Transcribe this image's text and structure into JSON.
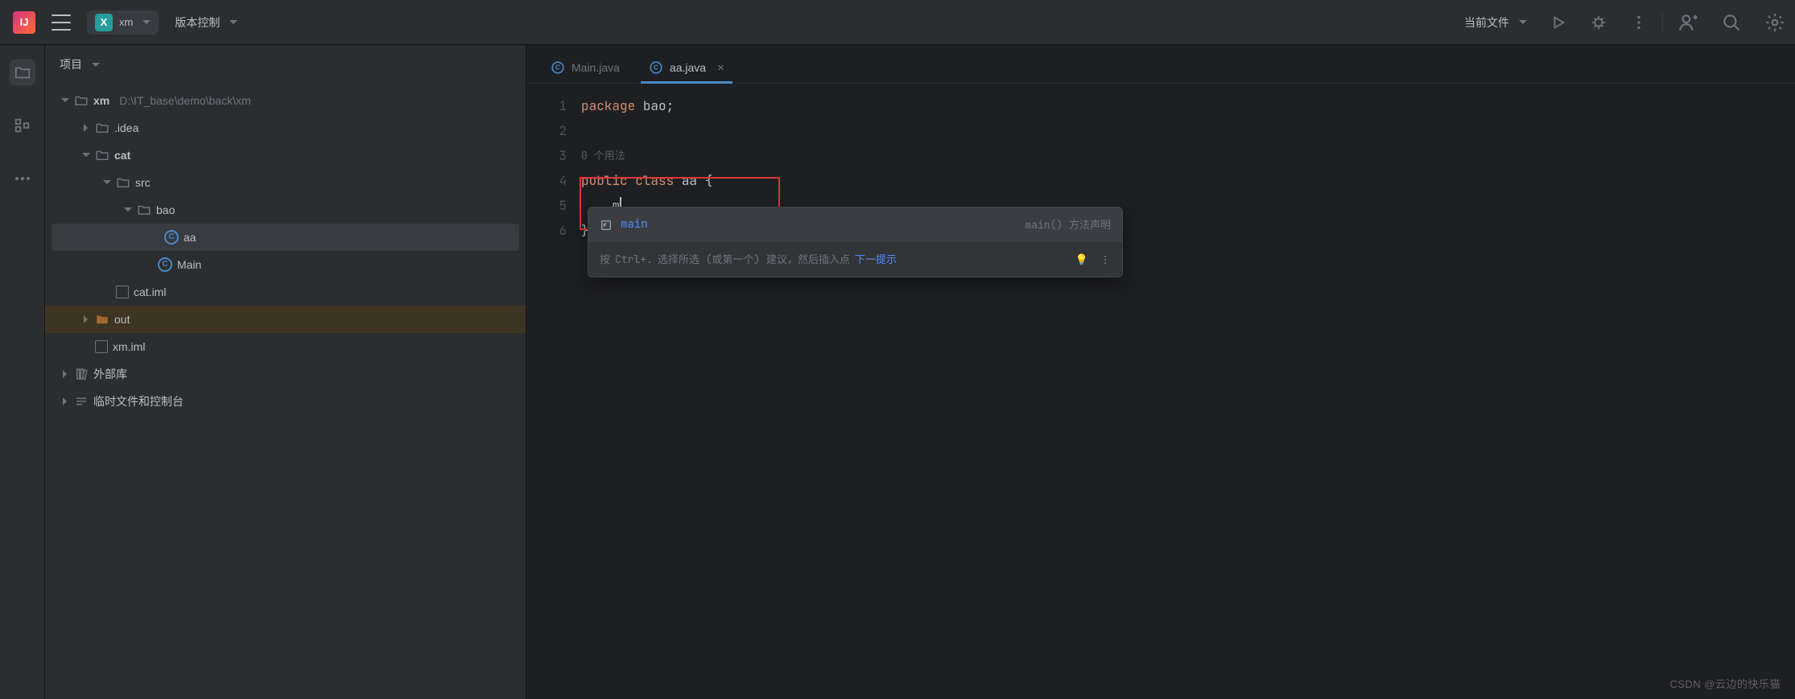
{
  "topbar": {
    "project_badge_letter": "X",
    "project_name": "xm",
    "vcs_label": "版本控制",
    "current_file_label": "当前文件"
  },
  "sidebar": {
    "title": "项目"
  },
  "tree": {
    "root_name": "xm",
    "root_path": "D:\\IT_base\\demo\\back\\xm",
    "items": [
      {
        "name": ".idea",
        "indent": 1,
        "icon": "folder",
        "arrow": "right"
      },
      {
        "name": "cat",
        "indent": 1,
        "icon": "folder",
        "arrow": "down",
        "bold": true
      },
      {
        "name": "src",
        "indent": 2,
        "icon": "folder",
        "arrow": "down"
      },
      {
        "name": "bao",
        "indent": 3,
        "icon": "package",
        "arrow": "down"
      },
      {
        "name": "aa",
        "indent": 4,
        "icon": "class",
        "selected": true
      },
      {
        "name": "Main",
        "indent": 4,
        "icon": "class"
      },
      {
        "name": "cat.iml",
        "indent": 2,
        "icon": "file"
      },
      {
        "name": "out",
        "indent": 1,
        "icon": "folder-orange",
        "arrow": "right",
        "highlighted": true
      },
      {
        "name": "xm.iml",
        "indent": 1,
        "icon": "file"
      }
    ],
    "external_libs": "外部库",
    "scratches": "临时文件和控制台"
  },
  "tabs": [
    {
      "label": "Main.java",
      "active": false,
      "closeable": false
    },
    {
      "label": "aa.java",
      "active": true,
      "closeable": true
    }
  ],
  "code": {
    "lines": [
      "1",
      "2",
      "",
      "3",
      "4",
      "5",
      "6"
    ],
    "l1_kw": "package ",
    "l1_rest": "bao;",
    "inlay": "0 个用法",
    "l3_kw1": "public ",
    "l3_kw2": "class ",
    "l3_rest": "aa {",
    "l4_indent": "    m",
    "l5": "}"
  },
  "popup": {
    "item_label": "main",
    "item_meta": "main() 方法声明",
    "hint_prefix": "按 ",
    "hint_key": "Ctrl+.",
    "hint_mid": " 选择所选 (或第一个) 建议，然后插入点 ",
    "hint_link": "下一提示"
  },
  "watermark": "CSDN @云边的快乐猫"
}
